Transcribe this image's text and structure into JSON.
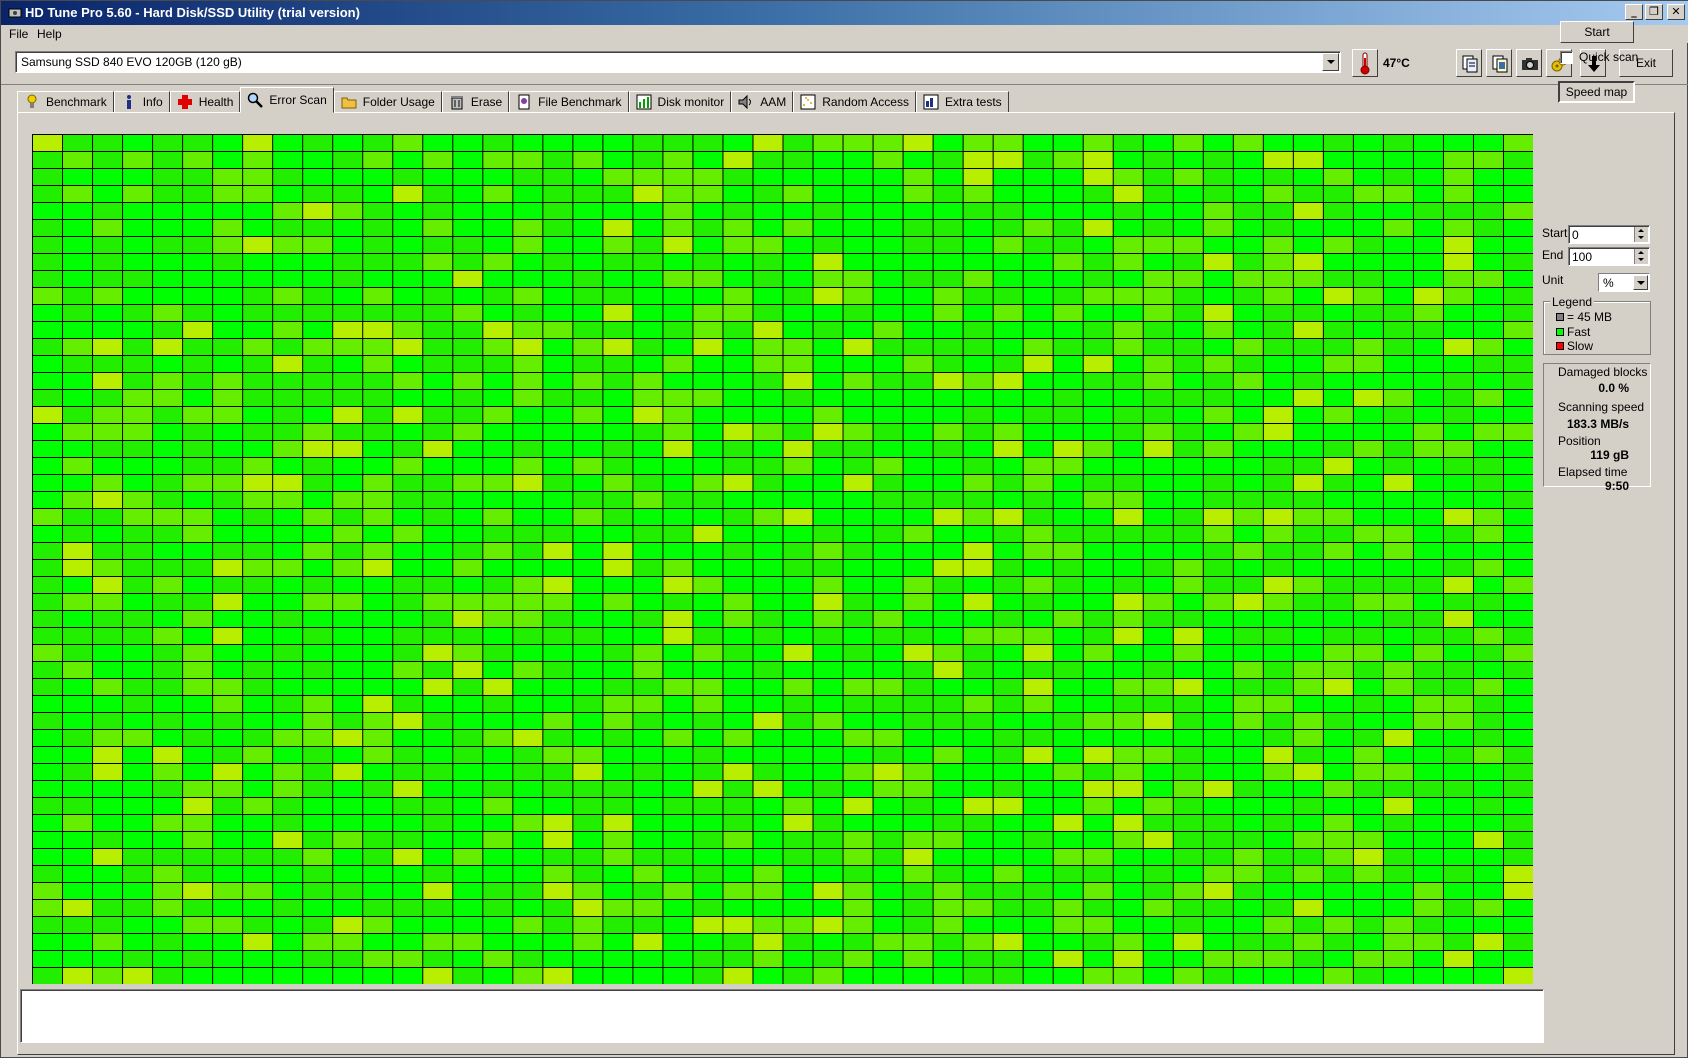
{
  "window": {
    "title": "HD Tune Pro 5.60 - Hard Disk/SSD Utility (trial version)",
    "controls": [
      "minimize",
      "restore",
      "close"
    ]
  },
  "menu": {
    "file": "File",
    "help": "Help"
  },
  "drive": {
    "selected": "Samsung SSD 840 EVO 120GB (120 gB)",
    "temperature": "47°C"
  },
  "toolbar": {
    "icons": [
      "copy-text-icon",
      "copy-info-icon",
      "screenshot-icon",
      "options-icon",
      "save-icon"
    ],
    "exit_label": "Exit"
  },
  "tabs": [
    {
      "label": "Benchmark",
      "icon": "benchmark-icon"
    },
    {
      "label": "Info",
      "icon": "info-icon"
    },
    {
      "label": "Health",
      "icon": "health-icon"
    },
    {
      "label": "Error Scan",
      "icon": "magnifier-icon"
    },
    {
      "label": "Folder Usage",
      "icon": "folder-icon"
    },
    {
      "label": "Erase",
      "icon": "trash-icon"
    },
    {
      "label": "File Benchmark",
      "icon": "file-benchmark-icon"
    },
    {
      "label": "Disk monitor",
      "icon": "disk-monitor-icon"
    },
    {
      "label": "AAM",
      "icon": "speaker-icon"
    },
    {
      "label": "Random Access",
      "icon": "random-access-icon"
    },
    {
      "label": "Extra tests",
      "icon": "extra-tests-icon"
    }
  ],
  "active_tab": "Error Scan",
  "scan": {
    "start_label": "Start",
    "quick_scan_label": "Quick scan",
    "quick_scan_checked": false,
    "speed_map_label": "Speed map",
    "speed_map_pressed": true,
    "start_field_label": "Start",
    "start_value": "0",
    "end_field_label": "End",
    "end_value": "100",
    "unit_label": "Unit",
    "unit_value": "%"
  },
  "legend": {
    "title": "Legend",
    "items": [
      {
        "label": "= 45 MB",
        "color": "#808080"
      },
      {
        "label": "Fast",
        "color": "#00ff00"
      },
      {
        "label": "Slow",
        "color": "#ff0000"
      }
    ]
  },
  "stats": {
    "damaged_label": "Damaged blocks",
    "damaged_value": "0.0 %",
    "speed_label": "Scanning speed",
    "speed_value": "183.3 MB/s",
    "position_label": "Position",
    "position_value": "119 gB",
    "elapsed_label": "Elapsed time",
    "elapsed_value": "9:50"
  },
  "speed_map": {
    "columns": 50,
    "rows": 50,
    "colors": {
      "fast": "#00ff00",
      "medium": "#22ee00",
      "slower": "#66ee00",
      "slowest": "#b8ee00"
    },
    "note_levels": "0=fast, 1=medium, 2=slower, 3=slowest"
  }
}
